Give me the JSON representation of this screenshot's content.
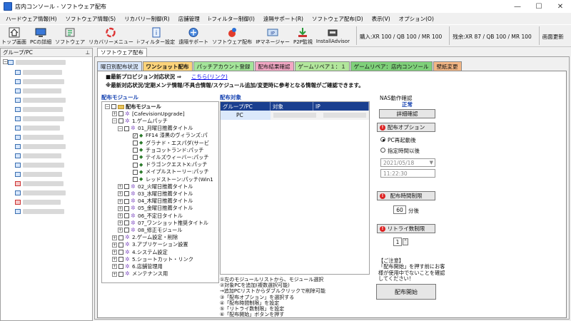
{
  "window": {
    "title": "店内コンソール - ソフトウェア配布"
  },
  "menu": [
    "ハードウェア情報(H)",
    "ソフトウェア情報(S)",
    "リカバリー制御(R)",
    "店舗管理",
    "i-フィルター制御(I)",
    "遠隔サポート(R)",
    "ソフトウェア配布(D)",
    "表示(V)",
    "オプション(O)"
  ],
  "toolbar": {
    "buttons": [
      {
        "label": "トップ画面",
        "icon": "home-icon"
      },
      {
        "label": "PCの詳細",
        "icon": "pc-detail-icon"
      },
      {
        "label": "ソフトウェア",
        "icon": "software-icon"
      },
      {
        "label": "リカバリーメニュー",
        "icon": "recovery-icon"
      },
      {
        "label": "i-フィルター設定",
        "icon": "filter-icon"
      },
      {
        "label": "遠隔サポート",
        "icon": "remote-support-icon"
      },
      {
        "label": "ソフトウェア配布",
        "icon": "software-distribution-icon"
      },
      {
        "label": "IPマネージャー",
        "icon": "ip-manager-icon"
      },
      {
        "label": "P2P監視",
        "icon": "p2p-icon"
      },
      {
        "label": "InstallAdvisor",
        "icon": "install-advisor-icon"
      }
    ],
    "status1": "購入:XR 100 / QB 100 / MR 100",
    "status2": "残余:XR 87 / QB 100 / MR 100",
    "refresh": "画面更新"
  },
  "left_panel": {
    "title": "グループ/PC",
    "pin": "⊥"
  },
  "main_tab": "ソフトウェア配布",
  "subtabs": [
    {
      "label": "曜日別配布状況",
      "color": "#d9e7fb"
    },
    {
      "label": "ワンショット配布",
      "color": "#fcd37a"
    },
    {
      "label": "パッチアカウント登録",
      "color": "#a4e59a"
    },
    {
      "label": "配布結果確認",
      "color": "#f2a7c4"
    },
    {
      "label": "ゲームリペア１：１",
      "color": "#b2e69c"
    },
    {
      "label": "ゲームリペア：店内コンソール",
      "color": "#7fd07a"
    },
    {
      "label": "壁紙変更",
      "color": "#f3b684"
    }
  ],
  "notice": {
    "line1": "■最新プロビジョン対応状況 ⇒",
    "link": "こちら(リンク)",
    "line2": "※最新対応状況/定期メンテ情報/不具合情報/スケジュール追加/変更時に参考となる情報がご確認できます。"
  },
  "module_title": "配布モジュール",
  "target_title": "配布対象",
  "tree": [
    {
      "label": "配布モジュール",
      "level": 0,
      "exp": "−",
      "kind": "folder",
      "bold": true
    },
    {
      "label": "[CafevisionUpgrade]",
      "level": 1,
      "exp": "+",
      "kind": "gear"
    },
    {
      "label": "1.ゲームパッチ",
      "level": 1,
      "exp": "−",
      "kind": "gear"
    },
    {
      "label": "01_月曜日推薦タイトル",
      "level": 2,
      "exp": "−",
      "kind": "gear"
    },
    {
      "label": "FF14 漆黒のヴィランズ:パ",
      "level": 3,
      "exp": "",
      "kind": "item",
      "checked": true
    },
    {
      "label": "グラナド・エスパダ(サービ",
      "level": 3,
      "exp": "",
      "kind": "item"
    },
    {
      "label": "チョコットランド:パッチ",
      "level": 3,
      "exp": "",
      "kind": "item"
    },
    {
      "label": "テイルズウィーバー:パッチ",
      "level": 3,
      "exp": "",
      "kind": "item"
    },
    {
      "label": "ドラゴンクエストX:パッチ",
      "level": 3,
      "exp": "",
      "kind": "item"
    },
    {
      "label": "メイプルストーリー:パッチ",
      "level": 3,
      "exp": "",
      "kind": "item"
    },
    {
      "label": "レッドストーン:パッチ(Win1",
      "level": 3,
      "exp": "",
      "kind": "item"
    },
    {
      "label": "02_火曜日推薦タイトル",
      "level": 2,
      "exp": "+",
      "kind": "gear"
    },
    {
      "label": "03_水曜日推薦タイトル",
      "level": 2,
      "exp": "+",
      "kind": "gear"
    },
    {
      "label": "04_木曜日推薦タイトル",
      "level": 2,
      "exp": "+",
      "kind": "gear"
    },
    {
      "label": "05_金曜日推薦タイトル",
      "level": 2,
      "exp": "+",
      "kind": "gear"
    },
    {
      "label": "06_不定日タイトル",
      "level": 2,
      "exp": "+",
      "kind": "gear"
    },
    {
      "label": "07_ワンショット推奨タイトル",
      "level": 2,
      "exp": "+",
      "kind": "gear"
    },
    {
      "label": "08_修正モジュール",
      "level": 2,
      "exp": "+",
      "kind": "gear"
    },
    {
      "label": "2.ゲーム設定・削除",
      "level": 1,
      "exp": "+",
      "kind": "gear"
    },
    {
      "label": "3.アプリケーション設置",
      "level": 1,
      "exp": "+",
      "kind": "gear"
    },
    {
      "label": "4.システム設定",
      "level": 1,
      "exp": "+",
      "kind": "gear"
    },
    {
      "label": "5.ショートカット・リンク",
      "level": 1,
      "exp": "+",
      "kind": "gear"
    },
    {
      "label": "6.店舗管理用",
      "level": 1,
      "exp": "+",
      "kind": "gear"
    },
    {
      "label": "メンテナンス用",
      "level": 1,
      "exp": "+",
      "kind": "gear"
    }
  ],
  "dist_table": {
    "headers": [
      "グループ/PC",
      "対象",
      "IP"
    ],
    "row": {
      "group": "PC",
      "target": "",
      "ip": ""
    }
  },
  "instructions": [
    "①左のモジュールリストから、モジュール選択",
    "②対象PCを追加(複数選択可能)",
    "→追加PCリストからダブルクリックで削除可能",
    "③「配布オプション」を選択する",
    "④「配布時間制限」を設定",
    "⑤「リトライ数制限」を設定",
    "⑥「配布開始」ボタンを押す"
  ],
  "right": {
    "nas_label": "NAS動作確認",
    "nas_status": "正常",
    "detail_button": "詳細確認",
    "option_head": "配布オプション",
    "opt_restart": "PC再起動後",
    "opt_time": "指定時間以後",
    "date_value": "2021/05/18",
    "time_value": "11:22:30",
    "time_limit_head": "配布時間制限",
    "time_limit_value": "60",
    "time_limit_unit": "分後",
    "retry_head": "リトライ数制限",
    "retry_value": "1",
    "note_title": "【ご注意】",
    "note_body": "「配布開始」を押す前にお客様が使用中でないことを確認してください！",
    "start_button": "配布開始"
  }
}
